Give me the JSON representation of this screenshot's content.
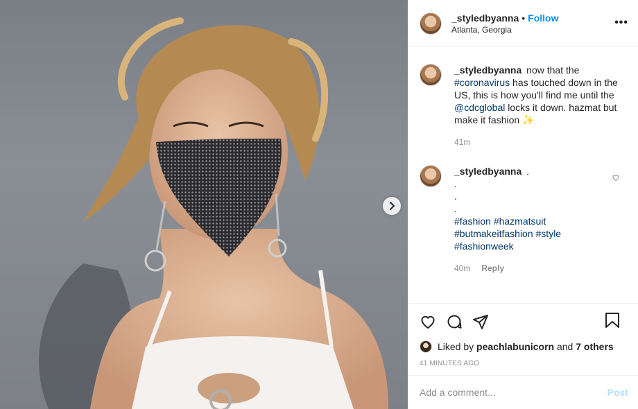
{
  "header": {
    "username": "_styledbyanna",
    "separator": "•",
    "follow_label": "Follow",
    "location": "Atlanta, Georgia",
    "more_label": "•••"
  },
  "caption": {
    "username": "_styledbyanna",
    "text_1": "now that the",
    "hashtag_1": "#coronavirus",
    "text_2": "has touched down in the US, this is how you'll find me until the",
    "mention_1": "@cdcglobal",
    "text_3": "locks it down. hazmat but make it fashion",
    "emoji": "✨",
    "time": "41m"
  },
  "comment_1": {
    "username": "_styledbyanna",
    "lines": [
      ".",
      ".",
      ".",
      "."
    ],
    "hashtags_line_1": "#fashion #hazmatsuit",
    "hashtags_line_2": "#butmakeitfashion #style",
    "hashtags_line_3": "#fashionweek",
    "time": "40m",
    "reply_label": "Reply"
  },
  "likes": {
    "prefix": "Liked by",
    "user": "peachlabunicorn",
    "joiner": "and",
    "others": "7 others"
  },
  "timestamp": "41 MINUTES AGO",
  "add_comment": {
    "placeholder": "Add a comment...",
    "post_label": "Post"
  },
  "colors": {
    "link_blue": "#0095f6",
    "hashtag_blue": "#00376b",
    "muted": "#8e8e8e"
  },
  "icons": [
    "chevron-right-icon",
    "more-icon",
    "heart-icon",
    "comment-icon",
    "share-icon",
    "bookmark-icon"
  ]
}
